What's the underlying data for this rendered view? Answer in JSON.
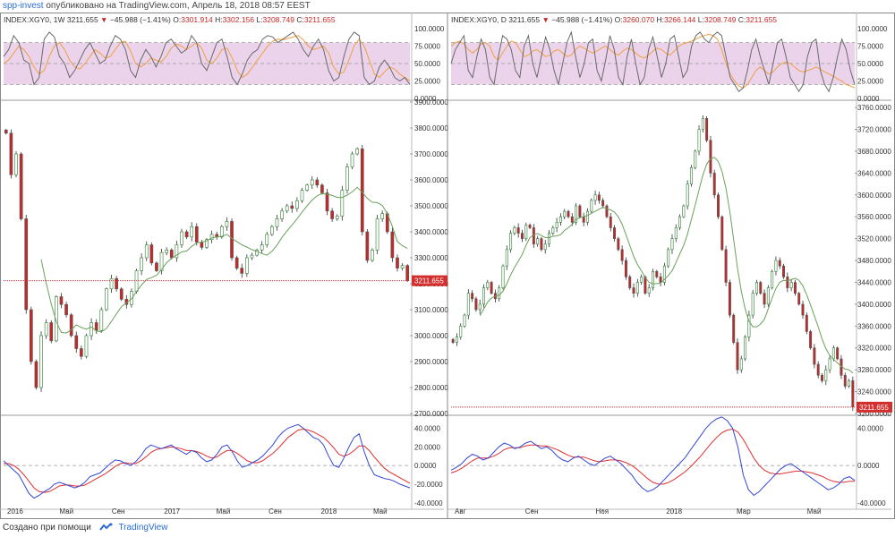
{
  "header": {
    "author": "spp-invest",
    "published_text": "опубликовано на TradingView.com, Апрель 18, 2018 08:57 EEST"
  },
  "footer": {
    "made_with": "Создано при помощи",
    "brand": "TradingView"
  },
  "colors": {
    "up": "#2e7d32",
    "down": "#c62828",
    "ma": "#6aa15a",
    "stoch_k": "#6a6a6a",
    "stoch_d": "#f0a040",
    "stoch_band": "#e6c8e6",
    "macd": "#3347d6",
    "signal": "#e03030",
    "price_line": "#d32f2f"
  },
  "panels": [
    {
      "id": "weekly",
      "legend": {
        "symbol": "INDEX:XGY0, 1W",
        "last": "3211.655",
        "change": "−45.988 (−1.41%)",
        "o_label": "O:",
        "o": "3301.914",
        "h_label": "H:",
        "h": "3302.156",
        "l_label": "L:",
        "l": "3208.749",
        "c_label": "C:",
        "c": "3211.655"
      },
      "price_tag": "3211.655",
      "price_ticks": [
        "3900.0000",
        "3800.0000",
        "3700.0000",
        "3600.0000",
        "3500.0000",
        "3400.0000",
        "3300.0000",
        "3200.0000",
        "3100.0000",
        "3000.0000",
        "2900.0000",
        "2800.0000",
        "2700.0000"
      ],
      "stoch_ticks": [
        "100.0000",
        "75.0000",
        "50.0000",
        "25.0000",
        "0.0000"
      ],
      "macd_ticks": [
        "40.0000",
        "20.0000",
        "0.0000",
        "-20.0000",
        "-40.0000"
      ],
      "time_ticks": [
        "2016",
        "Май",
        "Сен",
        "2017",
        "Май",
        "Сен",
        "2018",
        "Май"
      ]
    },
    {
      "id": "daily",
      "legend": {
        "symbol": "INDEX:XGY0, D",
        "last": "3211.655",
        "change": "−45.988 (−1.41%)",
        "o_label": "O:",
        "o": "3260.070",
        "h_label": "H:",
        "h": "3266.144",
        "l_label": "L:",
        "l": "3208.749",
        "c_label": "C:",
        "c": "3211.655"
      },
      "price_tag": "3211.655",
      "price_ticks": [
        "3760.0000",
        "3720.0000",
        "3680.0000",
        "3640.0000",
        "3600.0000",
        "3560.0000",
        "3520.0000",
        "3480.0000",
        "3440.0000",
        "3400.0000",
        "3360.0000",
        "3320.0000",
        "3280.0000",
        "3240.0000",
        "3200.0000"
      ],
      "stoch_ticks": [
        "100.0000",
        "75.0000",
        "50.0000",
        "25.0000",
        "0.0000"
      ],
      "macd_ticks": [
        "40.0000",
        "0.0000",
        "-40.0000"
      ],
      "time_ticks": [
        "Авг",
        "Сен",
        "Ноя",
        "2018",
        "Мар",
        "Май"
      ]
    }
  ],
  "chart_data": [
    {
      "type": "candlestick",
      "timeframe": "1W",
      "ylim": [
        2700,
        3900
      ],
      "last_close": 3211.655,
      "closes": [
        3780,
        3620,
        3700,
        3450,
        3100,
        2900,
        2800,
        3000,
        3050,
        2980,
        3150,
        3120,
        3080,
        3000,
        2950,
        2920,
        3000,
        3050,
        3020,
        3100,
        3180,
        3220,
        3180,
        3140,
        3120,
        3170,
        3250,
        3300,
        3350,
        3280,
        3250,
        3320,
        3330,
        3300,
        3350,
        3400,
        3380,
        3420,
        3360,
        3340,
        3370,
        3390,
        3380,
        3420,
        3440,
        3300,
        3260,
        3240,
        3300,
        3310,
        3330,
        3350,
        3390,
        3420,
        3450,
        3480,
        3500,
        3490,
        3520,
        3560,
        3580,
        3600,
        3580,
        3550,
        3480,
        3450,
        3460,
        3560,
        3650,
        3700,
        3720,
        3400,
        3290,
        3330,
        3450,
        3470,
        3400,
        3300,
        3260,
        3270,
        3212
      ],
      "ma_period": 20,
      "stoch_k_approx": [
        60,
        70,
        90,
        80,
        55,
        50,
        20,
        30,
        85,
        95,
        88,
        60,
        50,
        30,
        40,
        55,
        70,
        80,
        65,
        50,
        55,
        75,
        90,
        85,
        70,
        40,
        30,
        55,
        70,
        60,
        45,
        60,
        80,
        85,
        75,
        65,
        70,
        90,
        80,
        50,
        40,
        60,
        80,
        85,
        60,
        30,
        20,
        35,
        55,
        65,
        70,
        85,
        90,
        88,
        80,
        85,
        90,
        95,
        85,
        70,
        60,
        75,
        85,
        70,
        40,
        25,
        30,
        60,
        85,
        95,
        90,
        30,
        20,
        25,
        45,
        55,
        45,
        30,
        25,
        30,
        20
      ],
      "stoch_d_approx": [
        50,
        55,
        65,
        75,
        70,
        60,
        45,
        35,
        40,
        60,
        75,
        80,
        70,
        55,
        45,
        42,
        50,
        60,
        70,
        65,
        58,
        60,
        70,
        80,
        82,
        68,
        50,
        45,
        50,
        58,
        55,
        52,
        60,
        72,
        78,
        75,
        70,
        75,
        80,
        72,
        55,
        50,
        58,
        70,
        72,
        58,
        40,
        30,
        35,
        45,
        55,
        65,
        75,
        82,
        85,
        84,
        86,
        88,
        90,
        84,
        75,
        70,
        72,
        75,
        65,
        45,
        35,
        38,
        55,
        75,
        85,
        75,
        55,
        35,
        30,
        38,
        45,
        42,
        35,
        30,
        25
      ],
      "macd_approx": [
        5,
        0,
        -5,
        -10,
        -20,
        -30,
        -35,
        -32,
        -28,
        -25,
        -20,
        -18,
        -20,
        -22,
        -24,
        -22,
        -18,
        -12,
        -10,
        -8,
        -3,
        2,
        6,
        5,
        2,
        0,
        4,
        10,
        18,
        22,
        20,
        18,
        20,
        22,
        18,
        15,
        12,
        16,
        14,
        8,
        4,
        6,
        12,
        20,
        22,
        15,
        5,
        -2,
        0,
        3,
        6,
        10,
        16,
        22,
        30,
        36,
        40,
        42,
        44,
        40,
        35,
        30,
        28,
        22,
        10,
        0,
        -2,
        8,
        20,
        30,
        34,
        15,
        0,
        -10,
        -12,
        -14,
        -15,
        -17,
        -20,
        -22,
        -24
      ],
      "signal_approx": [
        2,
        2,
        0,
        -4,
        -10,
        -17,
        -24,
        -28,
        -29,
        -28,
        -25,
        -22,
        -21,
        -21,
        -22,
        -22,
        -21,
        -18,
        -15,
        -12,
        -9,
        -5,
        -1,
        2,
        3,
        2,
        2,
        5,
        9,
        14,
        17,
        18,
        19,
        20,
        19,
        18,
        16,
        16,
        15,
        13,
        10,
        8,
        9,
        13,
        16,
        16,
        13,
        9,
        5,
        3,
        3,
        5,
        9,
        13,
        18,
        24,
        30,
        34,
        38,
        39,
        38,
        36,
        33,
        30,
        25,
        19,
        12,
        10,
        12,
        16,
        21,
        21,
        16,
        9,
        3,
        -3,
        -7,
        -10,
        -13,
        -16,
        -19
      ]
    },
    {
      "type": "candlestick",
      "timeframe": "D",
      "ylim": [
        3200,
        3770
      ],
      "last_close": 3211.655,
      "closes": [
        3330,
        3340,
        3360,
        3380,
        3420,
        3410,
        3390,
        3400,
        3430,
        3440,
        3420,
        3410,
        3430,
        3470,
        3500,
        3530,
        3540,
        3530,
        3520,
        3545,
        3540,
        3510,
        3520,
        3500,
        3510,
        3530,
        3540,
        3550,
        3560,
        3570,
        3560,
        3550,
        3580,
        3560,
        3550,
        3570,
        3590,
        3600,
        3590,
        3580,
        3560,
        3540,
        3520,
        3500,
        3480,
        3450,
        3430,
        3420,
        3440,
        3450,
        3420,
        3430,
        3460,
        3450,
        3440,
        3470,
        3500,
        3520,
        3540,
        3560,
        3580,
        3620,
        3650,
        3680,
        3720,
        3740,
        3700,
        3640,
        3600,
        3560,
        3500,
        3440,
        3380,
        3330,
        3280,
        3300,
        3340,
        3380,
        3420,
        3440,
        3420,
        3400,
        3430,
        3460,
        3480,
        3470,
        3450,
        3430,
        3440,
        3420,
        3400,
        3380,
        3350,
        3320,
        3290,
        3270,
        3260,
        3280,
        3300,
        3320,
        3300,
        3270,
        3250,
        3260,
        3212
      ],
      "ma_period": 20,
      "stoch_k_approx": [
        50,
        70,
        80,
        90,
        40,
        30,
        60,
        85,
        70,
        30,
        20,
        60,
        90,
        85,
        70,
        40,
        30,
        75,
        90,
        50,
        30,
        60,
        88,
        70,
        40,
        20,
        50,
        80,
        95,
        60,
        30,
        50,
        80,
        85,
        40,
        25,
        55,
        90,
        70,
        30,
        20,
        60,
        85,
        50,
        20,
        30,
        70,
        88,
        60,
        30,
        50,
        85,
        90,
        60,
        30,
        40,
        75,
        90,
        95,
        85,
        80,
        90,
        95,
        90,
        60,
        30,
        20,
        10,
        15,
        40,
        70,
        85,
        60,
        40,
        20,
        50,
        80,
        85,
        60,
        30,
        20,
        10,
        20,
        60,
        80,
        85,
        40,
        20,
        10,
        30,
        60,
        85,
        70,
        40,
        20
      ],
      "stoch_d_approx": [
        75,
        80,
        82,
        78,
        70,
        65,
        70,
        78,
        80,
        75,
        60,
        55,
        65,
        75,
        82,
        80,
        70,
        60,
        62,
        68,
        70,
        65,
        60,
        62,
        68,
        70,
        65,
        60,
        62,
        70,
        75,
        72,
        68,
        65,
        68,
        72,
        75,
        70,
        65,
        62,
        68,
        72,
        70,
        65,
        60,
        58,
        62,
        68,
        72,
        70,
        65,
        62,
        68,
        75,
        78,
        80,
        82,
        85,
        88,
        90,
        92,
        90,
        85,
        70,
        50,
        35,
        25,
        18,
        15,
        20,
        30,
        40,
        45,
        40,
        35,
        38,
        45,
        50,
        52,
        50,
        45,
        40,
        38,
        40,
        42,
        45,
        42,
        38,
        35,
        32,
        28,
        25,
        20,
        18,
        15
      ],
      "macd_approx": [
        -5,
        -2,
        2,
        8,
        12,
        10,
        6,
        8,
        14,
        20,
        24,
        22,
        18,
        20,
        24,
        26,
        22,
        18,
        20,
        16,
        10,
        6,
        4,
        8,
        10,
        6,
        2,
        0,
        4,
        8,
        10,
        6,
        2,
        -4,
        -10,
        -18,
        -24,
        -28,
        -26,
        -22,
        -16,
        -10,
        -4,
        2,
        8,
        16,
        24,
        32,
        40,
        46,
        50,
        52,
        48,
        40,
        20,
        -10,
        -26,
        -32,
        -28,
        -22,
        -16,
        -10,
        -4,
        0,
        2,
        -2,
        -6,
        -10,
        -14,
        -18,
        -22,
        -26,
        -24,
        -20,
        -14,
        -12,
        -16
      ],
      "signal_approx": [
        -8,
        -6,
        -3,
        1,
        5,
        8,
        8,
        8,
        10,
        13,
        17,
        19,
        19,
        19,
        21,
        22,
        22,
        21,
        21,
        19,
        17,
        14,
        11,
        9,
        9,
        9,
        7,
        5,
        4,
        5,
        6,
        6,
        5,
        3,
        0,
        -4,
        -9,
        -14,
        -18,
        -20,
        -20,
        -18,
        -15,
        -11,
        -7,
        -2,
        4,
        10,
        17,
        24,
        30,
        35,
        38,
        39,
        36,
        28,
        18,
        8,
        0,
        -5,
        -8,
        -9,
        -9,
        -8,
        -7,
        -6,
        -6,
        -7,
        -8,
        -10,
        -12,
        -15,
        -17,
        -18,
        -18,
        -17,
        -17
      ]
    }
  ]
}
